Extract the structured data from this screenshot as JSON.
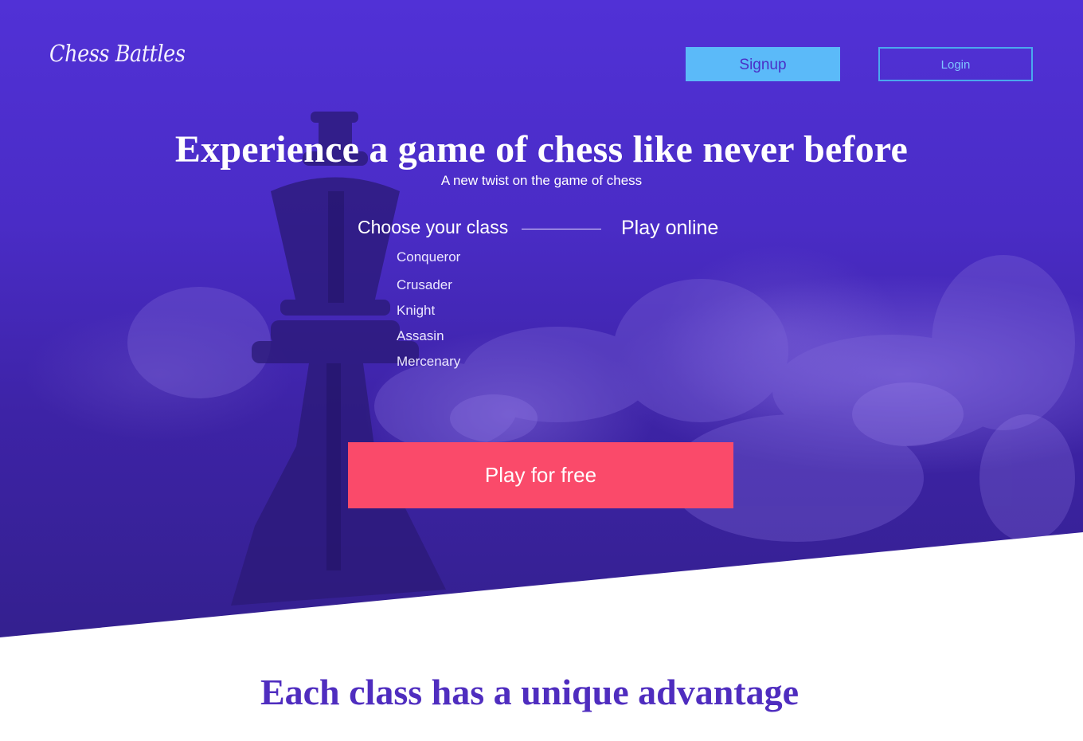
{
  "colors": {
    "hero_purple": "#4a2cc6",
    "signup_bg": "#5bbaf9",
    "login_border": "#4aa8ee",
    "cta_red": "#fa4a6a",
    "section_title": "#4f2dbf"
  },
  "nav": {
    "brand": "Chess Battles",
    "signup_label": "Signup",
    "login_label": "Login"
  },
  "hero": {
    "background_image": "king-chess-piece-icon",
    "title": "Experience a game of chess like never before",
    "subtitle": "A new twist on the game of chess",
    "choose_label": "Choose your class",
    "play_online_label": "Play online",
    "classes": [
      "Conqueror",
      "Crusader",
      "Knight",
      "Assasin",
      "Mercenary"
    ],
    "cta_label": "Play for free"
  },
  "section": {
    "title": "Each class has a unique advantage"
  }
}
